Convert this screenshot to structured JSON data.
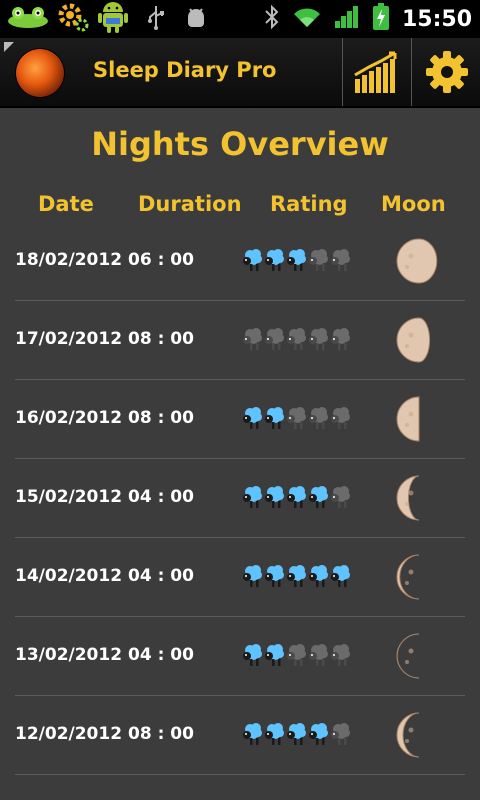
{
  "status_bar": {
    "time": "15:50",
    "icons": [
      "frog-icon",
      "gear-notification-icon",
      "android-icon",
      "usb-icon",
      "debug-icon",
      "bluetooth-icon",
      "wifi-icon",
      "signal-icon",
      "battery-charging-icon"
    ]
  },
  "app_bar": {
    "title": "Sleep Diary Pro",
    "logo_icon": "moon-logo-icon",
    "stats_icon": "bar-chart-icon",
    "settings_icon": "gear-icon"
  },
  "page": {
    "title": "Nights Overview",
    "columns": {
      "date": "Date",
      "duration": "Duration",
      "rating": "Rating",
      "moon": "Moon"
    }
  },
  "nights": [
    {
      "date": "18/02/2012",
      "duration": "06 : 00",
      "rating": 3,
      "moon_phase": 0.1
    },
    {
      "date": "17/02/2012",
      "duration": "08 : 00",
      "rating": 0,
      "moon_phase": 0.17
    },
    {
      "date": "16/02/2012",
      "duration": "08 : 00",
      "rating": 2,
      "moon_phase": 0.25
    },
    {
      "date": "15/02/2012",
      "duration": "04 : 00",
      "rating": 4,
      "moon_phase": 0.33
    },
    {
      "date": "14/02/2012",
      "duration": "04 : 00",
      "rating": 5,
      "moon_phase": 0.42
    },
    {
      "date": "13/02/2012",
      "duration": "04 : 00",
      "rating": 2,
      "moon_phase": 0.52
    },
    {
      "date": "12/02/2012",
      "duration": "08 : 00",
      "rating": 4,
      "moon_phase": 0.62
    }
  ],
  "colors": {
    "accent": "#f2c230",
    "background": "#3c3c3c",
    "rating_on": "#5fc3ff",
    "rating_off": "#6b6b6b",
    "moon": "#e2c7b0"
  }
}
